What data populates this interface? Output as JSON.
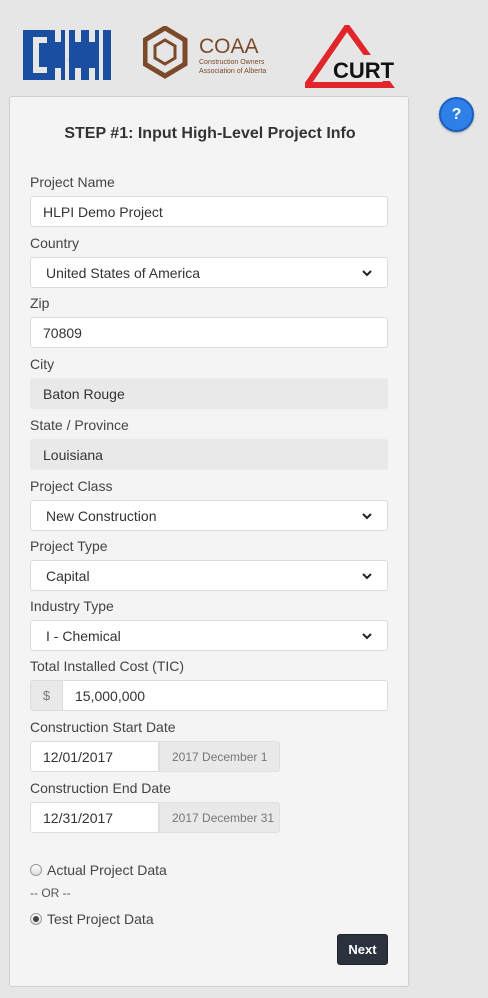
{
  "logos": {
    "cii_text": "CII",
    "coaa_text": "COAA",
    "coaa_sub1": "Construction Owners",
    "coaa_sub2": "Association of Alberta",
    "curt_text": "CURT"
  },
  "help_label": "?",
  "form": {
    "title": "STEP #1: Input High-Level Project Info",
    "project_name": {
      "label": "Project Name",
      "value": "HLPI Demo Project"
    },
    "country": {
      "label": "Country",
      "value": "United States of America"
    },
    "zip": {
      "label": "Zip",
      "value": "70809"
    },
    "city": {
      "label": "City",
      "value": "Baton Rouge"
    },
    "state": {
      "label": "State / Province",
      "value": "Louisiana"
    },
    "project_class": {
      "label": "Project Class",
      "value": "New Construction"
    },
    "project_type": {
      "label": "Project Type",
      "value": "Capital"
    },
    "industry_type": {
      "label": "Industry Type",
      "value": "I - Chemical"
    },
    "tic": {
      "label": "Total Installed Cost (TIC)",
      "currency": "$",
      "value": "15,000,000"
    },
    "start_date": {
      "label": "Construction Start Date",
      "value": "12/01/2017",
      "hint": "2017 December 1"
    },
    "end_date": {
      "label": "Construction End Date",
      "value": "12/31/2017",
      "hint": "2017 December 31"
    },
    "radio_actual": {
      "label": "Actual Project Data",
      "checked": false
    },
    "or_text": "-- OR --",
    "radio_test": {
      "label": "Test Project Data",
      "checked": true
    },
    "next_label": "Next"
  },
  "colors": {
    "cii_blue": "#1a4ea0",
    "coaa_brown": "#7a4a2a",
    "curt_red": "#e0252b",
    "help_blue": "#2f7fe8",
    "next_dark": "#2b323d"
  }
}
